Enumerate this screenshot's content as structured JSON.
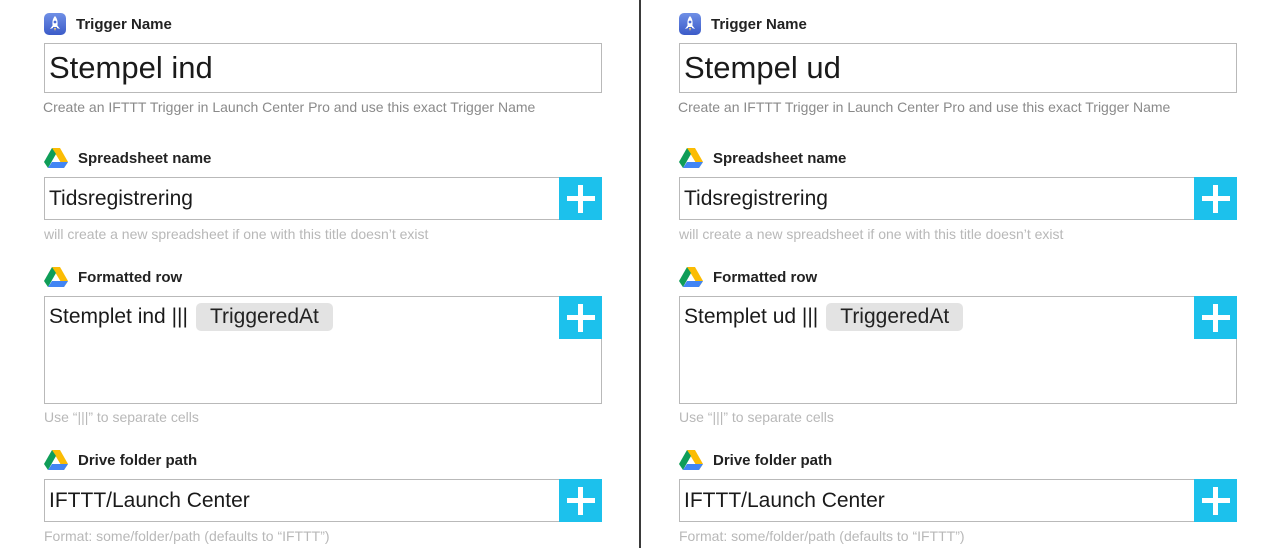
{
  "panels": [
    {
      "trigger_label": "Trigger Name",
      "trigger_value": "Stempel ind",
      "trigger_hint": "Create an IFTTT Trigger in Launch Center Pro and use this exact Trigger Name",
      "spreadsheet_label": "Spreadsheet name",
      "spreadsheet_value": "Tidsregistrering",
      "spreadsheet_hint": "will create a new spreadsheet if one with this title doesn’t exist",
      "row_label": "Formatted row",
      "row_text": "Stemplet ind |||",
      "row_token": "TriggeredAt",
      "row_hint": "Use “|||” to separate cells",
      "folder_label": "Drive folder path",
      "folder_value": "IFTTT/Launch Center",
      "folder_hint": "Format: some/folder/path (defaults to “IFTTT”)"
    },
    {
      "trigger_label": "Trigger Name",
      "trigger_value": "Stempel ud",
      "trigger_hint": "Create an IFTTT Trigger in Launch Center Pro and use this exact Trigger Name",
      "spreadsheet_label": "Spreadsheet name",
      "spreadsheet_value": "Tidsregistrering",
      "spreadsheet_hint": "will create a new spreadsheet if one with this title doesn’t exist",
      "row_label": "Formatted row",
      "row_text": "Stemplet ud |||",
      "row_token": "TriggeredAt",
      "row_hint": "Use “|||” to separate cells",
      "folder_label": "Drive folder path",
      "folder_value": "IFTTT/Launch Center",
      "folder_hint": "Format: some/folder/path (defaults to “IFTTT”)"
    }
  ],
  "icons": {
    "trigger": "rocket-icon",
    "drive": "google-drive-icon",
    "add": "plus-icon"
  },
  "colors": {
    "accent": "#1cc1ec",
    "hint": "#b8b8b8",
    "pill": "#e3e3e3"
  }
}
